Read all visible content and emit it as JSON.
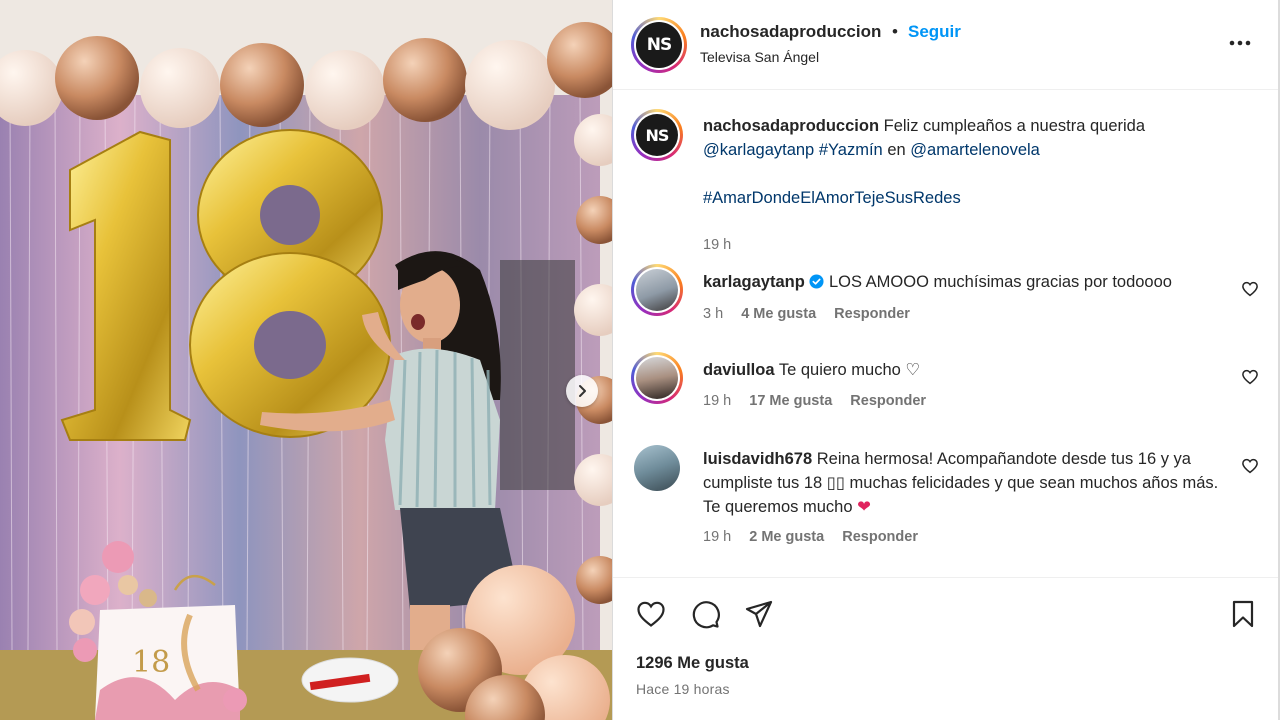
{
  "post": {
    "author": "nachosadaproduccion",
    "avatar_initials": "NS",
    "follow_label": "Seguir",
    "separator": "•",
    "location": "Televisa San Ángel",
    "caption": {
      "user": "nachosadaproduccion",
      "text_1": "Feliz cumpleaños a nuestra querida",
      "mention_1": "@karlagaytanp",
      "hashtag_1": "#Yazmín",
      "connector": "en",
      "mention_2": "@amartelenovela",
      "hashtag_2": "#AmarDondeElAmorTejeSusRedes",
      "time": "19 h"
    },
    "likes": "1296 Me gusta",
    "posted": "Hace 19 horas",
    "image": {
      "balloon_number": "18",
      "cake_label": "18"
    }
  },
  "comments": [
    {
      "user": "karlagaytanp",
      "verified": true,
      "text": "LOS AMOOO muchísimas gracias por todoooo",
      "time": "3 h",
      "likes": "4 Me gusta",
      "reply": "Responder"
    },
    {
      "user": "daviulloa",
      "text": "Te quiero mucho ♡",
      "time": "19 h",
      "likes": "17 Me gusta",
      "reply": "Responder"
    },
    {
      "user": "luisdavidh678",
      "text": "Reina hermosa! Acompañandote desde tus 16 y ya cumpliste tus 18 ▯▯ muchas felicidades y que sean muchos años más. Te queremos mucho ❤",
      "time": "19 h",
      "likes": "2 Me gusta",
      "reply": "Responder"
    }
  ],
  "icons": {
    "more": "more-options-icon",
    "heart": "heart-icon",
    "comment": "comment-icon",
    "share": "share-icon",
    "save": "bookmark-icon",
    "next": "chevron-right-icon",
    "verified": "verified-badge-icon"
  },
  "colors": {
    "link": "#00376b",
    "follow": "#0095f6",
    "muted": "#737373",
    "verified": "#0095f6",
    "heart_emoji": "#e0245e"
  }
}
